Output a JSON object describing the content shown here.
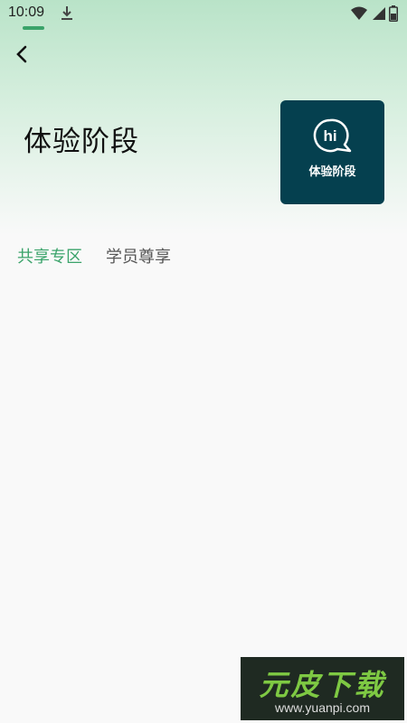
{
  "status_bar": {
    "time": "10:09",
    "icons": [
      "download-icon",
      "wifi-icon",
      "signal-icon",
      "battery-icon"
    ]
  },
  "header": {
    "back_icon": "back-arrow-icon",
    "title": "体验阶段"
  },
  "badge": {
    "icon": "hi-chat-bubble-icon",
    "icon_text": "hi",
    "label": "体验阶段",
    "background": "#05404f"
  },
  "tabs": [
    {
      "label": "共享专区",
      "active": true
    },
    {
      "label": "学员尊享",
      "active": false
    }
  ],
  "colors": {
    "accent": "#3aa36a",
    "hero_gradient_top": "#b9e3c8"
  },
  "watermark": {
    "brand": "元皮下载",
    "url": "www.yuanpi.com"
  }
}
